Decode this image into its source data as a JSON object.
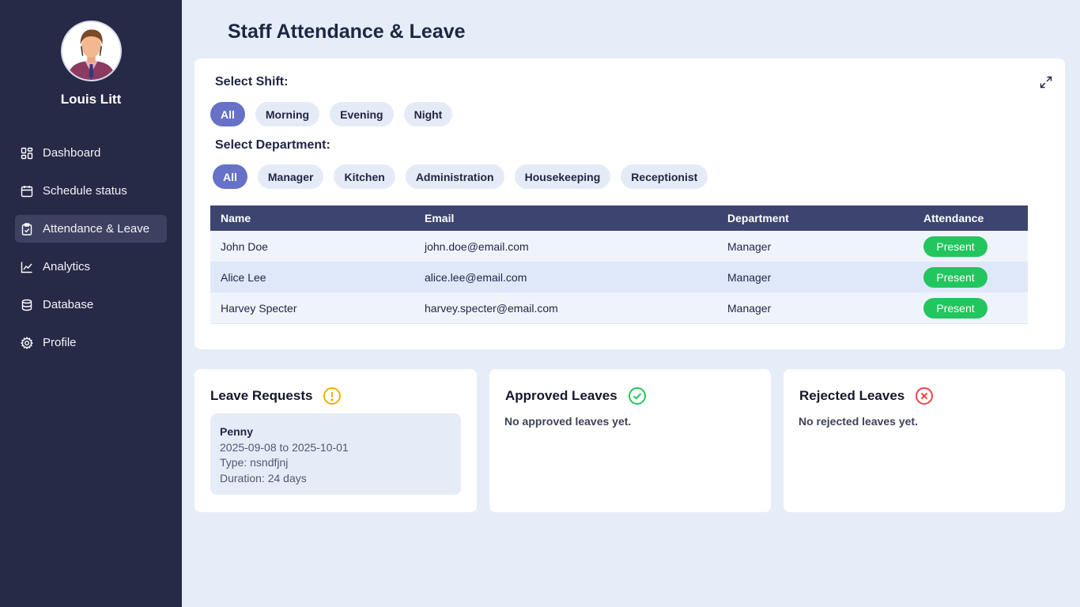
{
  "app": {
    "title": "Staff Attendance & Leave"
  },
  "user": {
    "name": "Louis Litt"
  },
  "sidebar": {
    "items": [
      {
        "label": "Dashboard",
        "icon": "dashboard-icon"
      },
      {
        "label": "Schedule status",
        "icon": "calendar-icon"
      },
      {
        "label": "Attendance & Leave",
        "icon": "clipboard-check-icon",
        "active": true
      },
      {
        "label": "Analytics",
        "icon": "line-chart-icon"
      },
      {
        "label": "Database",
        "icon": "database-icon"
      },
      {
        "label": "Profile",
        "icon": "gear-icon"
      }
    ]
  },
  "filters": {
    "shift_label": "Select Shift:",
    "shifts": [
      "All",
      "Morning",
      "Evening",
      "Night"
    ],
    "selected_shift": "All",
    "department_label": "Select Department:",
    "departments": [
      "All",
      "Manager",
      "Kitchen",
      "Administration",
      "Housekeeping",
      "Receptionist"
    ],
    "selected_department": "All"
  },
  "table": {
    "headers": [
      "Name",
      "Email",
      "Department",
      "Attendance"
    ],
    "rows": [
      {
        "name": "John Doe",
        "email": "john.doe@email.com",
        "department": "Manager",
        "attendance": "Present"
      },
      {
        "name": "Alice Lee",
        "email": "alice.lee@email.com",
        "department": "Manager",
        "attendance": "Present"
      },
      {
        "name": "Harvey Specter",
        "email": "harvey.specter@email.com",
        "department": "Manager",
        "attendance": "Present"
      }
    ]
  },
  "leave_requests": {
    "title": "Leave Requests",
    "items": [
      {
        "name": "Penny",
        "dates": "2025-09-08 to 2025-10-01",
        "type": "Type: nsndfjnj",
        "duration": "Duration: 24 days"
      }
    ]
  },
  "approved": {
    "title": "Approved Leaves",
    "empty": "No approved leaves yet."
  },
  "rejected": {
    "title": "Rejected Leaves",
    "empty": "No rejected leaves yet."
  },
  "colors": {
    "sidebar": "#262a47",
    "accent": "#6671c7",
    "table_header": "#3d4470",
    "present": "#22c55e",
    "warning": "#eab308",
    "success": "#22c55e",
    "danger": "#ef4444"
  }
}
